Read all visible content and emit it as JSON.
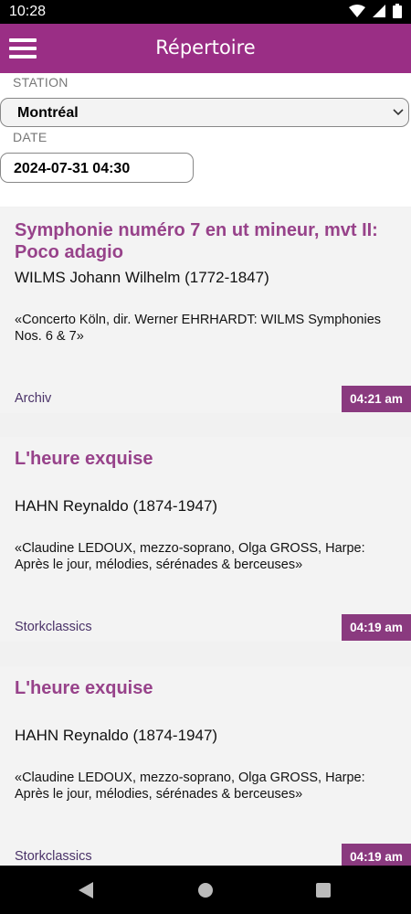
{
  "status": {
    "time": "10:28"
  },
  "appbar": {
    "title": "Répertoire"
  },
  "filters": {
    "station_label": "STATION",
    "station_value": "Montréal",
    "date_label": "DATE",
    "date_value": "2024-07-31 04:30"
  },
  "tracks": [
    {
      "title": "Symphonie numéro 7 en ut mineur, mvt II: Poco adagio",
      "composer": "WILMS Johann Wilhelm (1772-1847)",
      "album": "«Concerto Köln, dir. Werner EHRHARDT: WILMS Symphonies Nos. 6 & 7»",
      "label": "Archiv",
      "time": "04:21 am"
    },
    {
      "title": "L'heure exquise",
      "composer": "HAHN Reynaldo (1874-1947)",
      "album": "«Claudine LEDOUX, mezzo-soprano, Olga GROSS, Harpe: Après le jour, mélodies, sérénades & berceuses»",
      "label": "Storkclassics",
      "time": "04:19 am"
    },
    {
      "title": "L'heure exquise",
      "composer": "HAHN Reynaldo (1874-1947)",
      "album": "«Claudine LEDOUX, mezzo-soprano, Olga GROSS, Harpe: Après le jour, mélodies, sérénades & berceuses»",
      "label": "Storkclassics",
      "time": "04:19 am"
    }
  ],
  "colors": {
    "appbar": "#9a2e85",
    "title": "#97428a",
    "time_badge": "#8a3a7f"
  }
}
